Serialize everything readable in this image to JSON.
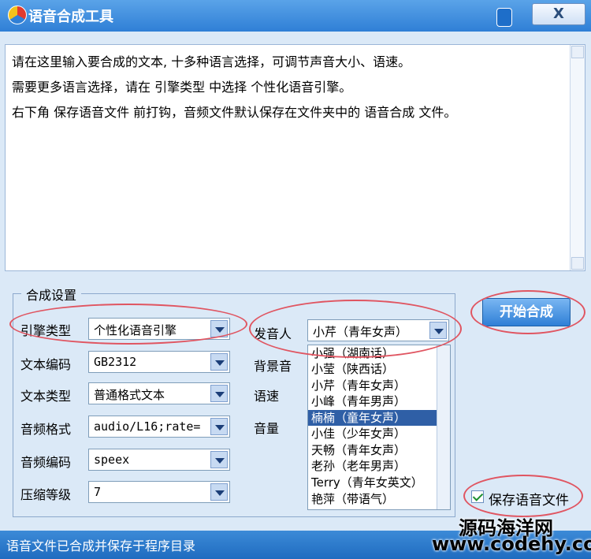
{
  "window": {
    "title": "语音合成工具",
    "close_label": "X"
  },
  "editor": {
    "lines": [
      "请在这里输入要合成的文本, 十多种语言选择，可调节声音大小、语速。",
      "需要更多语言选择，请在  引擎类型  中选择  个性化语音引擎。",
      "右下角  保存语音文件  前打钩，音频文件默认保存在文件夹中的  语音合成  文件。"
    ]
  },
  "settings": {
    "group_title": "合成设置",
    "engine_type": {
      "label": "引擎类型",
      "value": "个性化语音引擎"
    },
    "text_encoding": {
      "label": "文本编码",
      "value": "GB2312"
    },
    "text_type": {
      "label": "文本类型",
      "value": "普通格式文本"
    },
    "audio_format": {
      "label": "音频格式",
      "value": "audio/L16;rate="
    },
    "audio_codec": {
      "label": "音频编码",
      "value": "speex"
    },
    "compression_level": {
      "label": "压缩等级",
      "value": "7"
    },
    "speaker": {
      "label": "发音人",
      "value": "小芹（青年女声）"
    },
    "background_sound": {
      "label": "背景音"
    },
    "speed": {
      "label": "语速"
    },
    "volume": {
      "label": "音量"
    },
    "speaker_options": [
      "小强（湖南话）",
      "小莹（陕西话）",
      "小芹（青年女声）",
      "小峰（青年男声）",
      "楠楠（童年女声）",
      "小佳（少年女声）",
      "天畅（青年女声）",
      "老孙（老年男声）",
      "Terry（青年女英文）",
      "艳萍（带语气）"
    ],
    "selected_index": 4
  },
  "actions": {
    "start_label": "开始合成",
    "save_audio_label": "保存语音文件",
    "save_audio_checked": true
  },
  "status": {
    "text": "语音文件已合成并保存于程序目录"
  },
  "watermark": {
    "line1": "源码海洋网",
    "line2": "www.codehy.com"
  },
  "colors": {
    "titlebar": "#2f7fd6",
    "highlight_circle": "#e05561",
    "selected_item": "#2f5fa6"
  }
}
